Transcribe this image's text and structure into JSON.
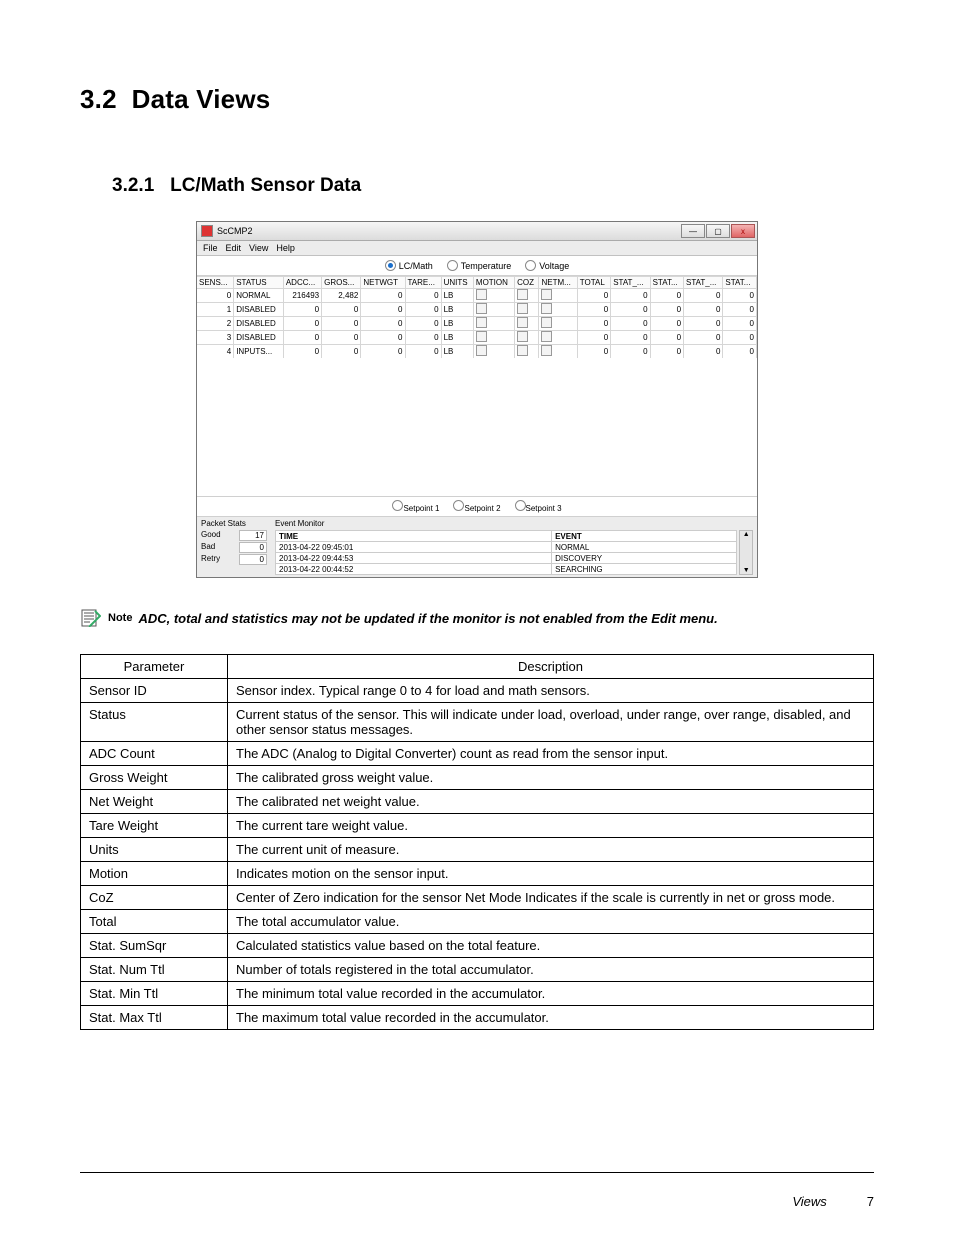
{
  "section": {
    "number": "3.2",
    "title": "Data Views"
  },
  "subsection": {
    "number": "3.2.1",
    "title": "LC/Math Sensor Data"
  },
  "app": {
    "title": "ScCMP2",
    "menus": [
      "File",
      "Edit",
      "View",
      "Help"
    ],
    "win": {
      "min": "—",
      "max": "▢",
      "close": "x"
    },
    "tabs": {
      "lcmath": "LC/Math",
      "temperature": "Temperature",
      "voltage": "Voltage"
    },
    "headers": [
      "SENS...",
      "STATUS",
      "ADCC...",
      "GROS...",
      "NETWGT",
      "TARE...",
      "UNITS",
      "MOTION",
      "COZ",
      "NETM...",
      "TOTAL",
      "STAT_...",
      "STAT...",
      "STAT_...",
      "STAT..."
    ],
    "rows": [
      {
        "sens": "0",
        "status": "NORMAL",
        "adc": "216493",
        "gross": "2,482",
        "net": "0",
        "tare": "0",
        "units": "LB",
        "total": "0",
        "s1": "0",
        "s2": "0",
        "s3": "0",
        "s4": "0"
      },
      {
        "sens": "1",
        "status": "DISABLED",
        "adc": "0",
        "gross": "0",
        "net": "0",
        "tare": "0",
        "units": "LB",
        "total": "0",
        "s1": "0",
        "s2": "0",
        "s3": "0",
        "s4": "0"
      },
      {
        "sens": "2",
        "status": "DISABLED",
        "adc": "0",
        "gross": "0",
        "net": "0",
        "tare": "0",
        "units": "LB",
        "total": "0",
        "s1": "0",
        "s2": "0",
        "s3": "0",
        "s4": "0"
      },
      {
        "sens": "3",
        "status": "DISABLED",
        "adc": "0",
        "gross": "0",
        "net": "0",
        "tare": "0",
        "units": "LB",
        "total": "0",
        "s1": "0",
        "s2": "0",
        "s3": "0",
        "s4": "0"
      },
      {
        "sens": "4",
        "status": "INPUTS...",
        "adc": "0",
        "gross": "0",
        "net": "0",
        "tare": "0",
        "units": "LB",
        "total": "0",
        "s1": "0",
        "s2": "0",
        "s3": "0",
        "s4": "0"
      }
    ],
    "setpoints": {
      "sp1": "Setpoint 1",
      "sp2": "Setpoint 2",
      "sp3": "Setpoint 3"
    },
    "packet": {
      "title": "Packet Stats",
      "good_l": "Good",
      "good_v": "17",
      "bad_l": "Bad",
      "bad_v": "0",
      "retry_l": "Retry",
      "retry_v": "0"
    },
    "eventmon": {
      "title": "Event Monitor",
      "h_time": "TIME",
      "h_event": "EVENT",
      "rows": [
        {
          "t": "2013-04-22 09:45:01",
          "e": "NORMAL"
        },
        {
          "t": "2013-04-22 09:44:53",
          "e": "DISCOVERY"
        },
        {
          "t": "2013-04-22 00:44:52",
          "e": "SEARCHING"
        }
      ],
      "up": "▲",
      "down": "▼"
    }
  },
  "note": {
    "label": "Note",
    "text": "ADC, total and statistics may not be updated if the monitor is not enabled from the Edit menu."
  },
  "params": {
    "h_param": "Parameter",
    "h_desc": "Description",
    "rows": [
      {
        "p": "Sensor ID",
        "d": "Sensor index. Typical range 0 to 4 for load and math sensors."
      },
      {
        "p": "Status",
        "d": "Current status of the sensor. This will indicate under load, overload, under range, over range, disabled, and other sensor status messages."
      },
      {
        "p": "ADC Count",
        "d": "The ADC (Analog to Digital Converter) count as read from the sensor input."
      },
      {
        "p": "Gross Weight",
        "d": "The calibrated gross weight value."
      },
      {
        "p": "Net Weight",
        "d": "The calibrated net weight value."
      },
      {
        "p": "Tare Weight",
        "d": "The current tare weight value."
      },
      {
        "p": "Units",
        "d": "The current unit of measure."
      },
      {
        "p": "Motion",
        "d": "Indicates motion on the sensor input."
      },
      {
        "p": "CoZ",
        "d": "Center of Zero indication for the sensor Net Mode Indicates if the scale is currently in net or gross mode."
      },
      {
        "p": "Total",
        "d": "The total accumulator value."
      },
      {
        "p": "Stat. SumSqr",
        "d": "Calculated statistics value based on the total feature."
      },
      {
        "p": "Stat. Num Ttl",
        "d": "Number of totals registered in the total accumulator."
      },
      {
        "p": "Stat. Min Ttl",
        "d": "The minimum total value recorded in the accumulator."
      },
      {
        "p": "Stat. Max Ttl",
        "d": "The maximum total value recorded in the accumulator."
      }
    ]
  },
  "footer": {
    "section": "Views",
    "page": "7"
  }
}
